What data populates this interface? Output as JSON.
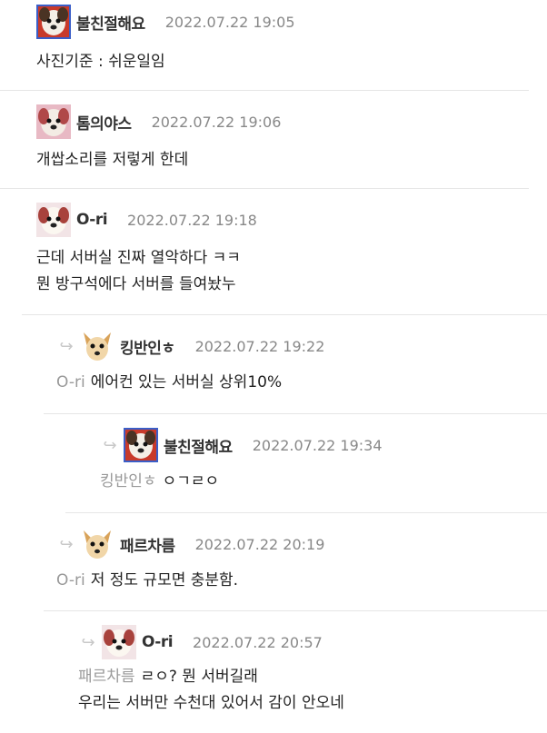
{
  "comments": [
    {
      "nick": "불친절해요",
      "date": "2022.07.22 19:05",
      "lines": [
        "사진기준 : 쉬운일임"
      ],
      "mention": "",
      "avatar": "dog-red"
    },
    {
      "nick": "톰의야스",
      "date": "2022.07.22 19:06",
      "lines": [
        "개쌉소리를 저렇게 한데"
      ],
      "mention": "",
      "avatar": "dog-pink"
    },
    {
      "nick": "O-ri",
      "date": "2022.07.22 19:18",
      "lines": [
        "근데 서버실 진짜 열악하다 ㅋㅋ",
        "뭔 방구석에다 서버를 들여놨누"
      ],
      "mention": "",
      "avatar": "dog-white"
    },
    {
      "nick": "킹반인ㅎ",
      "date": "2022.07.22 19:22",
      "lines": [
        "에어컨 있는 서버실 상위10%"
      ],
      "mention": "O-ri",
      "avatar": "chihuahua"
    },
    {
      "nick": "불친절해요",
      "date": "2022.07.22 19:34",
      "lines": [
        "ㅇㄱㄹㅇ"
      ],
      "mention": "킹반인ㅎ",
      "avatar": "dog-red"
    },
    {
      "nick": "패르차름",
      "date": "2022.07.22 20:19",
      "lines": [
        "저 정도 규모면 충분함."
      ],
      "mention": "O-ri",
      "avatar": "chihuahua"
    },
    {
      "nick": "O-ri",
      "date": "2022.07.22 20:57",
      "lines": [
        "ㄹㅇ? 뭔 서버길래",
        "우리는 서버만 수천대 있어서 감이 안오네"
      ],
      "mention": "패르차름",
      "avatar": "dog-white"
    }
  ],
  "icons": {
    "reply": "reply-arrow-icon"
  }
}
